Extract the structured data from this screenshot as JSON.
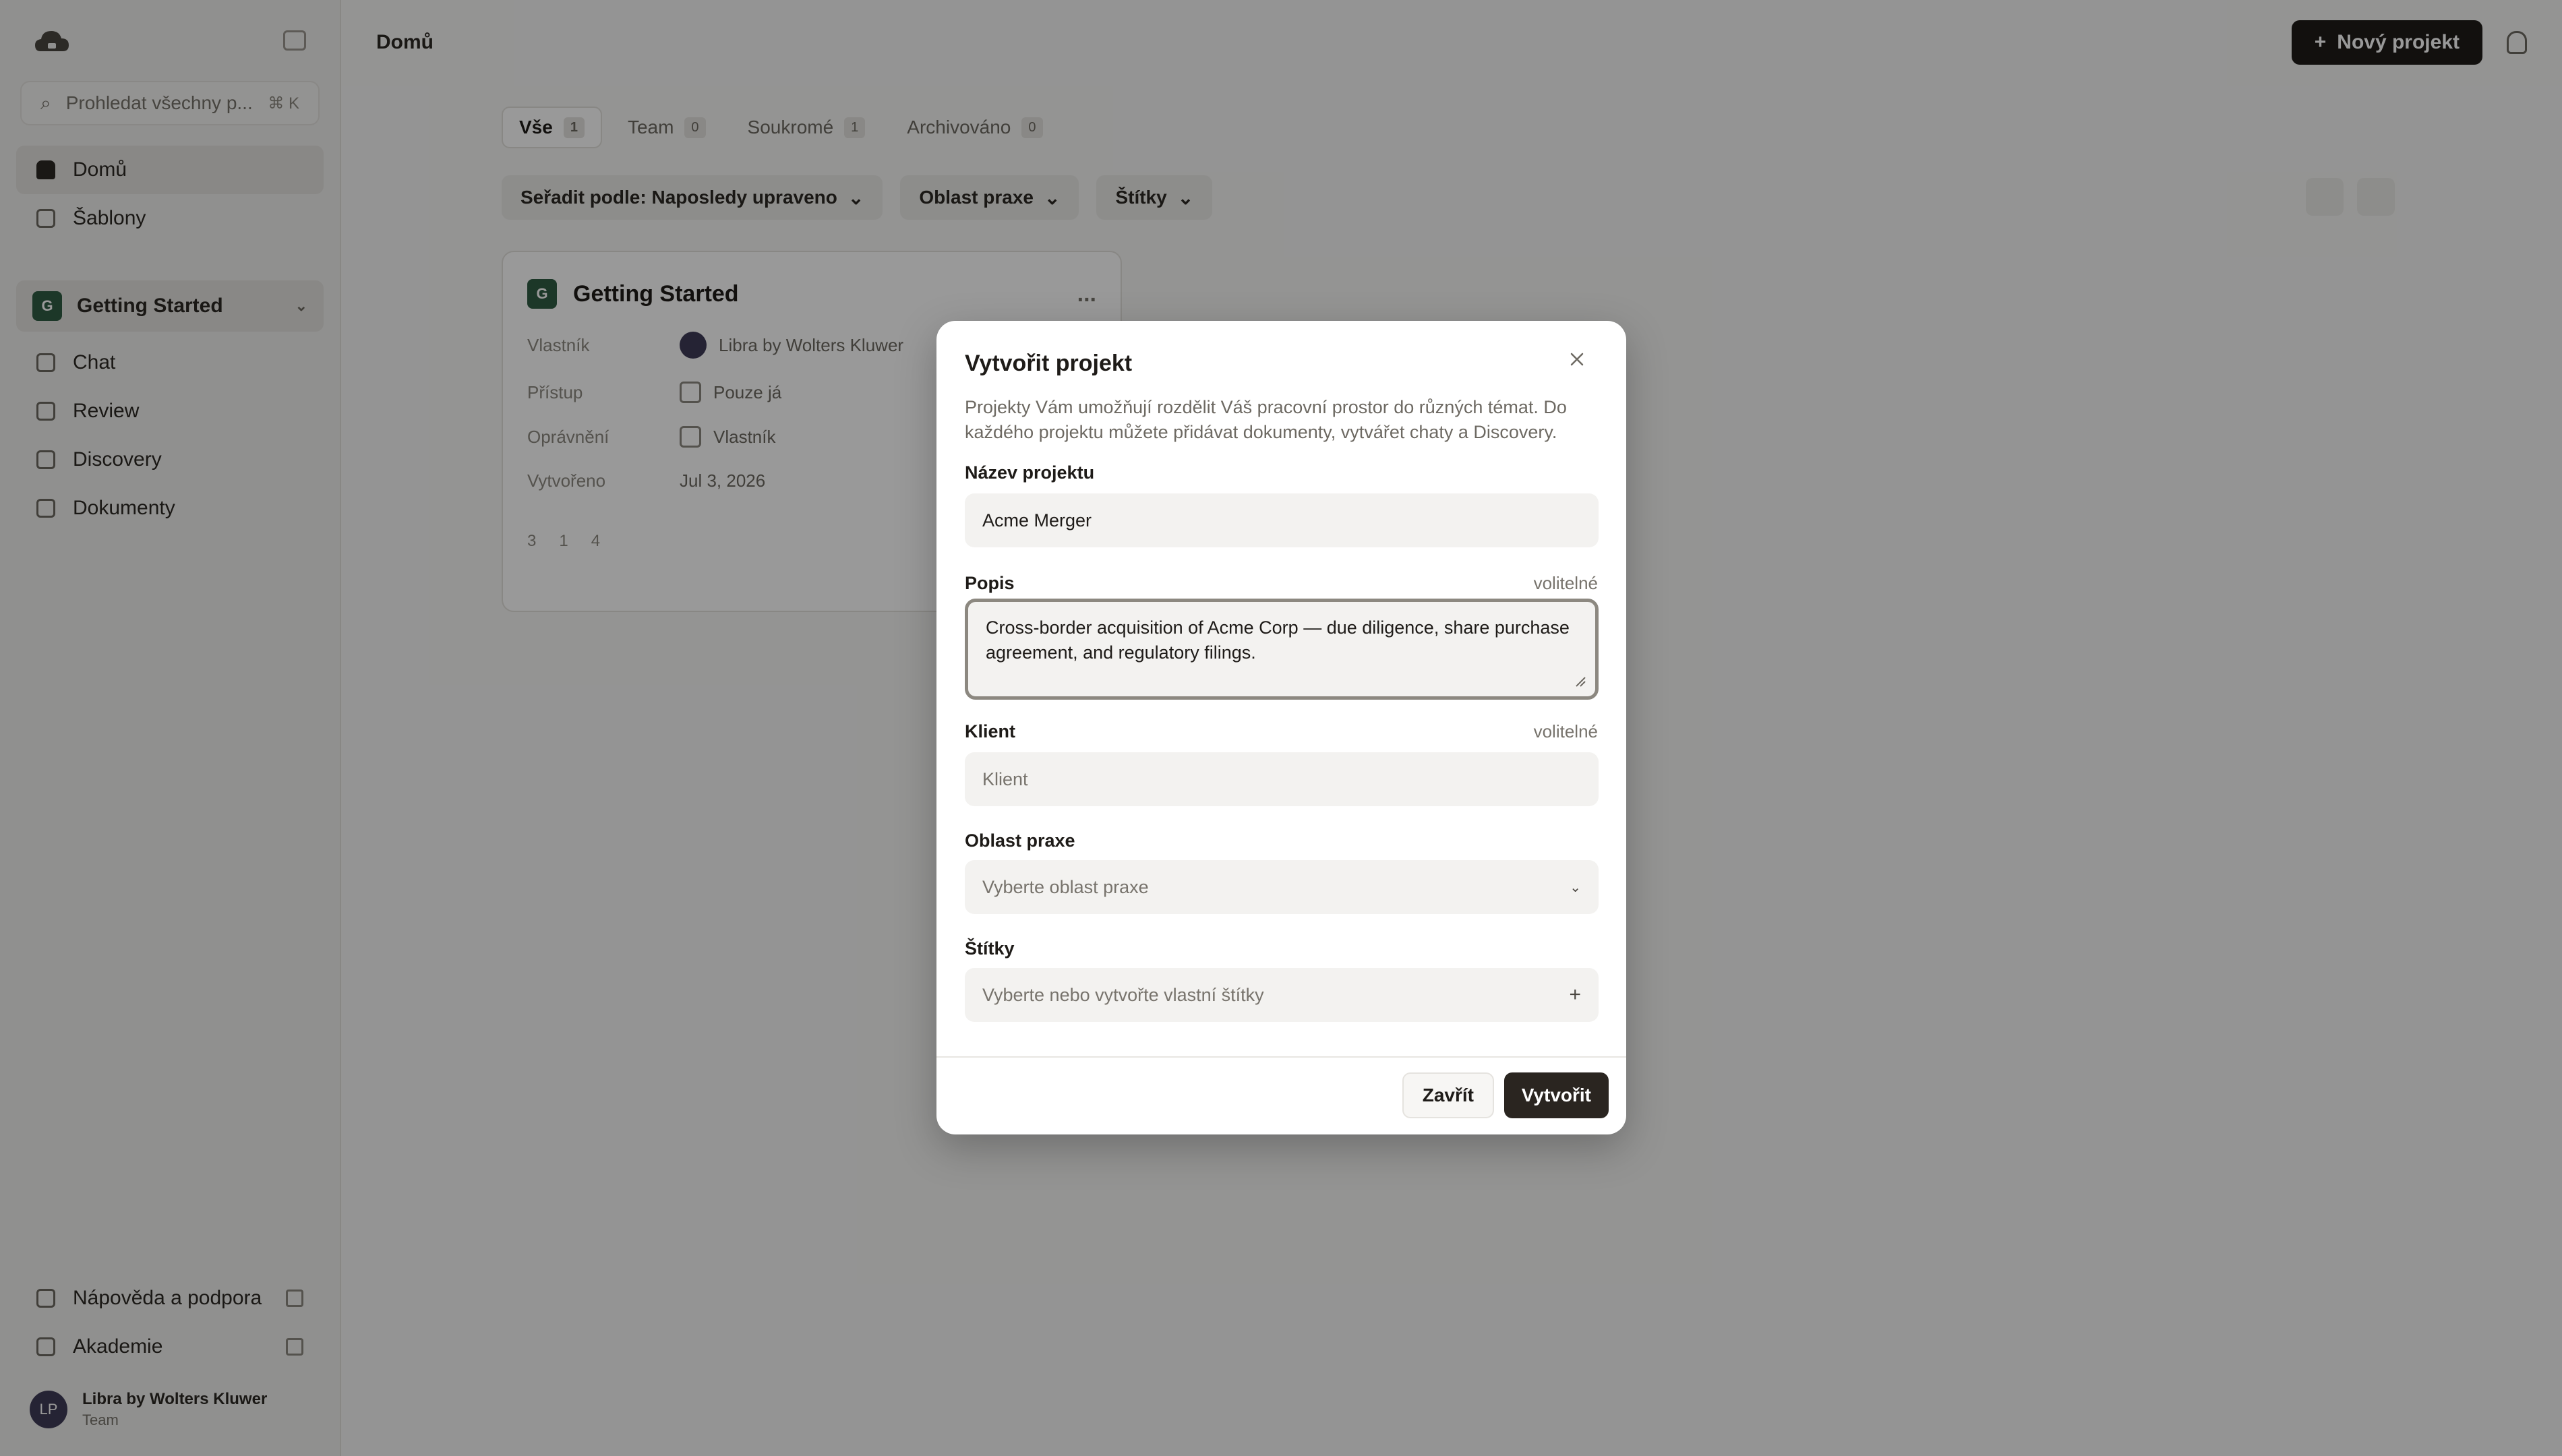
{
  "sidebar": {
    "search_placeholder": "Prohledat všechny p...",
    "search_shortcut": "⌘ K",
    "nav": [
      {
        "label": "Domů"
      },
      {
        "label": "Šablony"
      }
    ],
    "project": {
      "badge": "G",
      "name": "Getting Started"
    },
    "project_items": [
      {
        "label": "Chat"
      },
      {
        "label": "Review"
      },
      {
        "label": "Discovery"
      },
      {
        "label": "Dokumenty"
      }
    ],
    "bottom_items": [
      {
        "label": "Nápověda a podpora"
      },
      {
        "label": "Akademie"
      }
    ],
    "user": {
      "initials": "LP",
      "name": "Libra by Wolters Kluwer",
      "role": "Team"
    }
  },
  "header": {
    "breadcrumb": "Domů",
    "new_project_label": "Nový projekt",
    "new_project_icon": "+"
  },
  "tabs": [
    {
      "label": "Vše",
      "count": "1"
    },
    {
      "label": "Team",
      "count": "0"
    },
    {
      "label": "Soukromé",
      "count": "1"
    },
    {
      "label": "Archivováno",
      "count": "0"
    }
  ],
  "filters": {
    "sort": "Seřadit podle: Naposledy upraveno",
    "practice_area": "Oblast praxe",
    "tags": "Štítky"
  },
  "project_card": {
    "badge": "G",
    "title": "Getting Started",
    "menu": "...",
    "rows": [
      {
        "key": "Vlastník",
        "value": "Libra by Wolters Kluwer"
      },
      {
        "key": "Přístup",
        "value": "Pouze já"
      },
      {
        "key": "Oprávnění",
        "value": "Vlastník"
      },
      {
        "key": "Vytvořeno",
        "value": "Jul 3, 2026"
      }
    ],
    "stats": [
      "3",
      "1",
      "4"
    ]
  },
  "modal": {
    "title": "Vytvořit projekt",
    "description": "Projekty Vám umožňují rozdělit Váš pracovní prostor do různých témat. Do každého projektu můžete přidávat dokumenty, vytvářet chaty a Discovery.",
    "name_label": "Název projektu",
    "name_value": "Acme Merger",
    "description_label": "Popis",
    "optional": "volitelné",
    "description_value": "Cross-border acquisition of Acme Corp — due diligence, share purchase agreement, and regulatory filings.",
    "client_label": "Klient",
    "client_placeholder": "Klient",
    "practice_label": "Oblast praxe",
    "practice_placeholder": "Vyberte oblast praxe",
    "tags_label": "Štítky",
    "tags_placeholder": "Vyberte nebo vytvořte vlastní štítky",
    "tags_add_icon": "+",
    "close_button": "Zavřít",
    "create_button": "Vytvořit"
  },
  "colors": {
    "primary_button": "#2a2520",
    "project_badge": "#2f5d43",
    "overlay": "rgba(0,0,0,0.40)",
    "focus_border": "#8c8880"
  }
}
